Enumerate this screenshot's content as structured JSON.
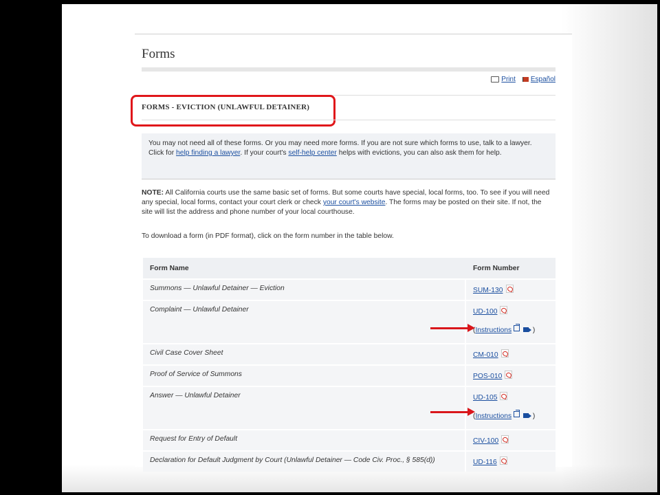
{
  "page": {
    "title": "Forms",
    "print_label": "Print",
    "espanol_label": "Español",
    "section_heading": "FORMS - EVICTION (UNLAWFUL DETAINER)"
  },
  "intro": {
    "part1": "You may not need all of these forms. Or you may need more forms. If you are not sure which forms to use, talk to a lawyer. Click for ",
    "link1": "help finding a lawyer",
    "part2": ". If your court's ",
    "link2": "self-help center",
    "part3": " helps with evictions, you can also ask them for help."
  },
  "note": {
    "label": "NOTE:",
    "part1": " All California courts use the same basic set of forms. But some courts have special, local forms, too. To see if you will need any special, local forms, contact your court clerk or check ",
    "link": "your court's website",
    "part2": ". The forms may be posted on their site. If not, the site will list the address and phone number of your local courthouse."
  },
  "download_text": "To download a form (in PDF format), click on the form number in the table below.",
  "table": {
    "headers": [
      "Form Name",
      "Form Number"
    ],
    "rows": [
      {
        "name": "Summons — Unlawful Detainer — Eviction",
        "number": "SUM-130"
      },
      {
        "name": "Complaint — Unlawful Detainer",
        "number": "UD-100",
        "instructions": "Instructions"
      },
      {
        "name": "Civil Case Cover Sheet",
        "number": "CM-010"
      },
      {
        "name": "Proof of Service of Summons",
        "number": "POS-010"
      },
      {
        "name": "Answer — Unlawful Detainer",
        "number": "UD-105",
        "instructions": "Instructions"
      },
      {
        "name": "Request for Entry of Default",
        "number": "CIV-100"
      },
      {
        "name": "Declaration for Default Judgment by Court (Unlawful Detainer — Code Civ. Proc., § 585(d))",
        "number": "UD-116"
      }
    ]
  },
  "colors": {
    "link": "#1a4e9f",
    "highlight": "#e0161a",
    "arrow": "#d9161b"
  }
}
